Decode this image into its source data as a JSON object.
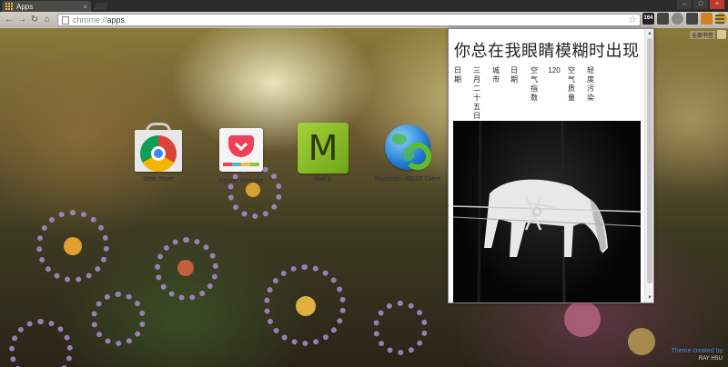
{
  "tab": {
    "title": "Apps",
    "close": "×"
  },
  "window": {
    "minimize": "–",
    "maximize": "□",
    "close": "×"
  },
  "nav": {
    "back": "←",
    "forward": "→",
    "reload": "↻",
    "home": "⌂"
  },
  "omnibox": {
    "scheme": "chrome://",
    "path": "apps",
    "star": "☆"
  },
  "extensions": {
    "badge": "164"
  },
  "bookmark_user": {
    "label": "全部书签"
  },
  "apps": [
    {
      "label": "Web Store",
      "icon": "chrome-web-store-icon"
    },
    {
      "label": "Pocket Website",
      "icon": "pocket-icon"
    },
    {
      "label": "Mail.p",
      "icon": "m-icon"
    },
    {
      "label": "Postman - REST Client",
      "icon": "postman-globe-icon"
    }
  ],
  "panel": {
    "title": "你总在我眼睛模糊时出现",
    "columns": [
      "日期",
      "三月二十五日",
      "城市",
      "日期",
      "120",
      "空气指数",
      "空气质量",
      "轻度污染"
    ],
    "photo": "horse-behind-barbed-wire"
  },
  "theme_credit": {
    "line1": "Theme created by",
    "line2": "RAY HSU"
  },
  "colors": {
    "accent": "#3a8ee6",
    "pocket": "#ee4056",
    "m_app": "#a6d13a"
  }
}
